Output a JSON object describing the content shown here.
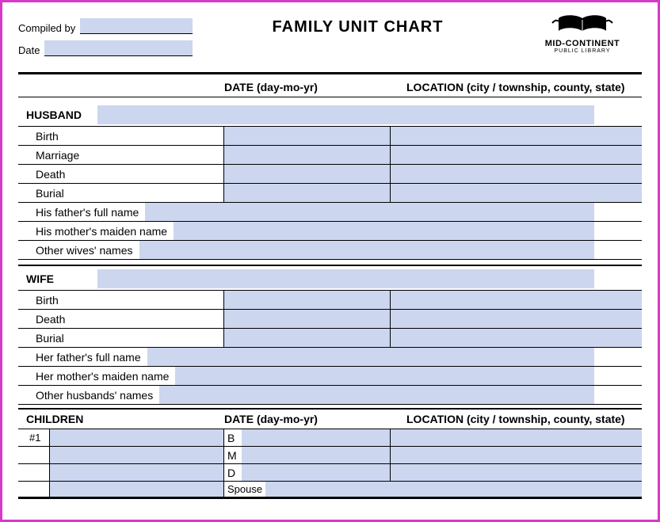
{
  "header": {
    "compiled_by_label": "Compiled by",
    "date_label": "Date",
    "title": "FAMILY UNIT CHART",
    "logo_line1": "MID-CONTINENT",
    "logo_line2": "PUBLIC LIBRARY"
  },
  "columns": {
    "date": "DATE (day-mo-yr)",
    "location": "LOCATION (city / township, county, state)"
  },
  "husband": {
    "label": "HUSBAND",
    "rows": {
      "birth": "Birth",
      "marriage": "Marriage",
      "death": "Death",
      "burial": "Burial"
    },
    "father": "His father's full name",
    "mother": "His mother's maiden name",
    "other": "Other wives' names"
  },
  "wife": {
    "label": "WIFE",
    "rows": {
      "birth": "Birth",
      "death": "Death",
      "burial": "Burial"
    },
    "father": "Her father's full name",
    "mother": "Her mother's maiden name",
    "other": "Other husbands' names"
  },
  "children": {
    "label": "CHILDREN",
    "date": "DATE (day-mo-yr)",
    "location": "LOCATION (city / township, county, state)",
    "child1_num": "#1",
    "codes": {
      "b": "B",
      "m": "M",
      "d": "D",
      "spouse": "Spouse"
    }
  }
}
